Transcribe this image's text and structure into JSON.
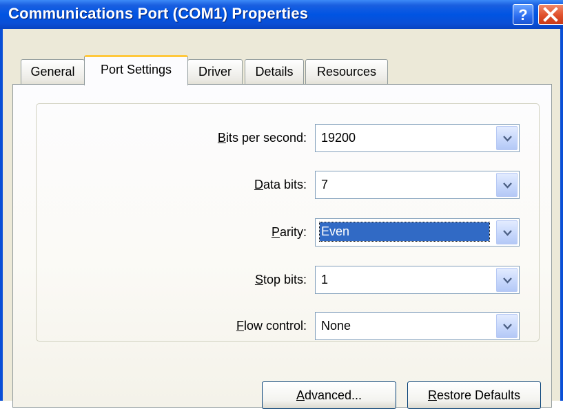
{
  "window": {
    "title": "Communications Port (COM1) Properties",
    "help_icon": "help-question-icon",
    "close_icon": "close-x-icon"
  },
  "tabs": [
    {
      "label": "General",
      "active": false
    },
    {
      "label": "Port Settings",
      "active": true
    },
    {
      "label": "Driver",
      "active": false
    },
    {
      "label": "Details",
      "active": false
    },
    {
      "label": "Resources",
      "active": false
    }
  ],
  "settings": {
    "bits_per_second": {
      "label_key": "B",
      "label_rest": "its per second:",
      "value": "19200"
    },
    "data_bits": {
      "label_key": "D",
      "label_rest": "ata bits:",
      "value": "7"
    },
    "parity": {
      "label_key": "P",
      "label_rest": "arity:",
      "value": "Even"
    },
    "stop_bits": {
      "label_key": "S",
      "label_rest": "top bits:",
      "value": "1"
    },
    "flow_control": {
      "label_key": "F",
      "label_rest": "low control:",
      "value": "None"
    }
  },
  "buttons": {
    "advanced": {
      "key": "A",
      "rest": "dvanced..."
    },
    "restore": {
      "key": "R",
      "rest": "estore Defaults"
    }
  },
  "colors": {
    "titlebar": "#0054e3",
    "selection": "#316ac5",
    "active_tab_accent": "#ffc83c"
  }
}
